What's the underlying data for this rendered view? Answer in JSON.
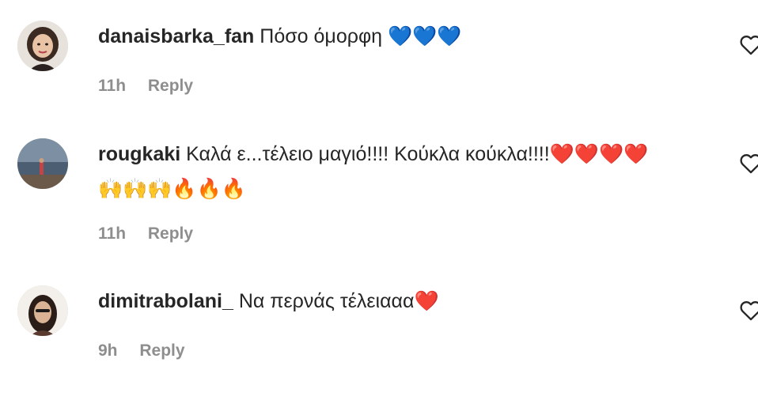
{
  "comments": [
    {
      "username": "danaisbarka_fan",
      "text": "Πόσο όμορφη ",
      "emoji": "💙💙💙",
      "time": "11h",
      "reply_label": "Reply"
    },
    {
      "username": "rougkaki",
      "text": "Καλά ε...τέλειο μαγιό!!!! Κούκλα κούκλα!!!!",
      "emoji": "❤️❤️❤️❤️",
      "emoji_line2_hands": "🙌🙌🙌",
      "emoji_line2_fire": "🔥🔥🔥",
      "time": "11h",
      "reply_label": "Reply"
    },
    {
      "username": "dimitrabolani_",
      "text": "Να περνάς τέλειααα",
      "emoji": "❤️",
      "time": "9h",
      "reply_label": "Reply"
    }
  ],
  "icons": {
    "like": "heart-outline-icon"
  },
  "colors": {
    "text": "#262626",
    "secondary": "#8e8e8e",
    "background": "#ffffff"
  }
}
